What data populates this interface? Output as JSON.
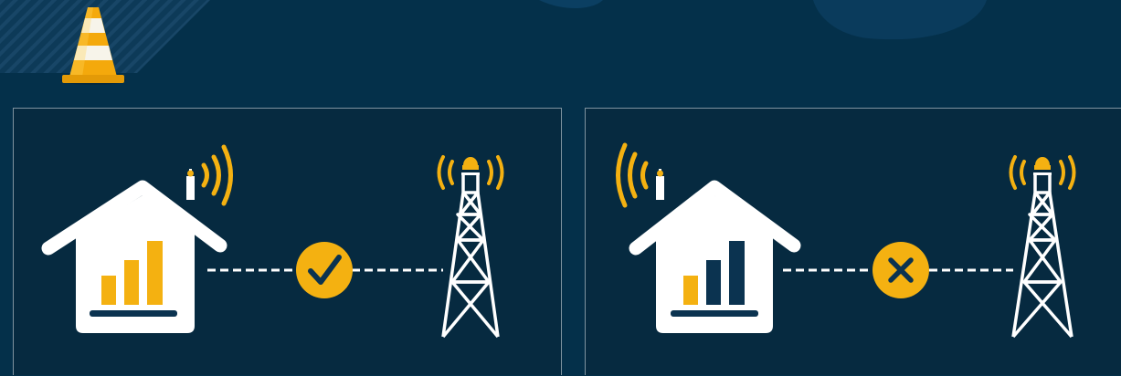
{
  "colors": {
    "background": "#04304a",
    "panel": "#062a40",
    "panel_border": "#7f93a0",
    "accent": "#f4b111",
    "house": "#ffffff",
    "bar_dark": "#0b3350"
  },
  "icons": {
    "warning": "traffic-cone-icon",
    "good_status": "checkmark-icon",
    "bad_status": "x-mark-icon",
    "tower": "cell-tower-icon",
    "home": "house-icon"
  },
  "scenarios": [
    {
      "id": "good",
      "status": "connected",
      "signal_bars_lit": 3,
      "signal_bars_total": 3
    },
    {
      "id": "bad",
      "status": "blocked",
      "signal_bars_lit": 1,
      "signal_bars_total": 3
    }
  ]
}
